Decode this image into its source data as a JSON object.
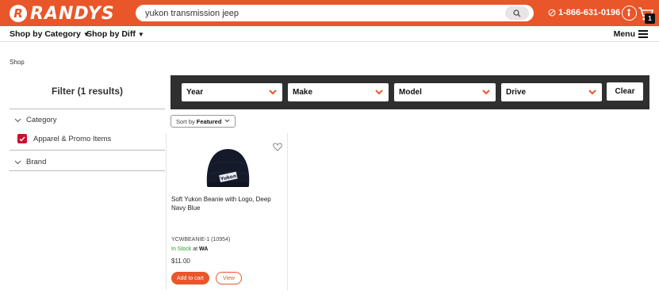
{
  "header": {
    "logo_letter": "R",
    "logo_text": "RANDYS",
    "search_value": "yukon transmission jeep",
    "phone": "1-866-631-0196",
    "cart_count": "1",
    "brand_color": "#e8562a"
  },
  "nav": {
    "shop_by_category": "Shop by Category",
    "shop_by_diff": "Shop by Diff",
    "menu": "Menu"
  },
  "breadcrumb": "Shop",
  "filter": {
    "title": "Filter (1 results)",
    "category_label": "Category",
    "category_option": "Apparel & Promo Items",
    "brand_label": "Brand"
  },
  "vehicle": {
    "year": "Year",
    "make": "Make",
    "model": "Model",
    "drive": "Drive",
    "clear": "Clear"
  },
  "sort": {
    "prefix": "Sort by",
    "value": "Featured"
  },
  "product": {
    "name": "Soft Yukon Beanie with Logo, Deep Navy Blue",
    "sku": "YCWBEANIE-1 (10954)",
    "stock_status": "In Stock",
    "stock_at": "at",
    "stock_location": "WA",
    "price": "$11.00",
    "add_to_cart": "Add to cart",
    "view": "View",
    "image_logo_text": "Yukon"
  }
}
